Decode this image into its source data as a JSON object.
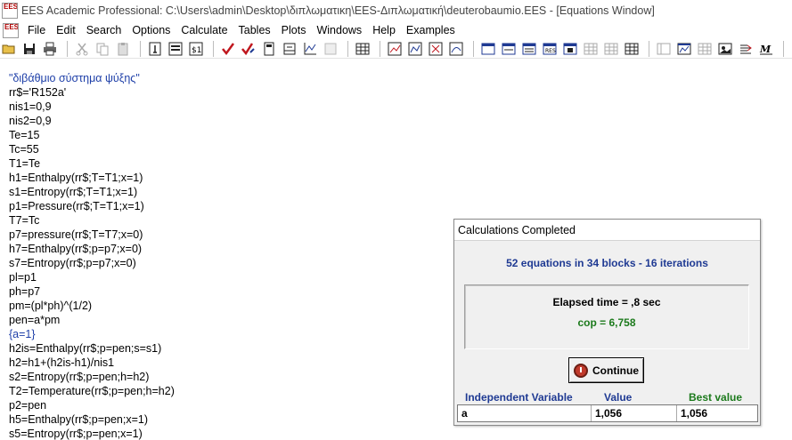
{
  "window": {
    "title": "EES Academic Professional:  C:\\Users\\admin\\Desktop\\διπλωματικη\\EES-Διπλωματική\\deuterobaumio.EES - [Equations Window]",
    "app_icon_text": "EES"
  },
  "menu": {
    "items": [
      "File",
      "Edit",
      "Search",
      "Options",
      "Calculate",
      "Tables",
      "Plots",
      "Windows",
      "Help",
      "Examples"
    ]
  },
  "toolbar": {
    "buttons": [
      {
        "name": "open-icon"
      },
      {
        "name": "save-icon"
      },
      {
        "name": "print-icon"
      },
      {
        "name": "cut-icon"
      },
      {
        "name": "copy-icon"
      },
      {
        "name": "paste-icon"
      },
      {
        "name": "info-icon"
      },
      {
        "name": "function-info-icon"
      },
      {
        "name": "units-icon"
      },
      {
        "name": "check-icon"
      },
      {
        "name": "solve-icon"
      },
      {
        "name": "calculator-icon"
      },
      {
        "name": "property-plot-icon"
      },
      {
        "name": "plot-icon"
      },
      {
        "name": "disabled-icon"
      },
      {
        "name": "table-icon"
      },
      {
        "name": "chart-line-icon"
      },
      {
        "name": "chart-line2-icon"
      },
      {
        "name": "chart-x-icon"
      },
      {
        "name": "chart-curve-icon"
      },
      {
        "name": "eqn-window-icon"
      },
      {
        "name": "formatted-eqn-icon"
      },
      {
        "name": "solution-icon"
      },
      {
        "name": "residuals-icon"
      },
      {
        "name": "param-table-icon"
      },
      {
        "name": "lookup-table-icon"
      },
      {
        "name": "array-table-icon"
      },
      {
        "name": "integral-table-icon"
      },
      {
        "name": "diagram-icon"
      },
      {
        "name": "plot-window-icon"
      },
      {
        "name": "grid-icon"
      },
      {
        "name": "picture-icon"
      },
      {
        "name": "text-icon"
      },
      {
        "name": "macro-icon"
      },
      {
        "name": "help-icon"
      },
      {
        "name": "pointer-icon"
      }
    ]
  },
  "equations": [
    {
      "text": "\"διβάθμιο σύστημα ψύξης\"",
      "comment": true
    },
    {
      "text": "rr$='R152a'"
    },
    {
      "text": "nis1=0,9"
    },
    {
      "text": "nis2=0,9"
    },
    {
      "text": "Te=15"
    },
    {
      "text": "Tc=55"
    },
    {
      "text": "T1=Te"
    },
    {
      "text": "h1=Enthalpy(rr$;T=T1;x=1)"
    },
    {
      "text": "s1=Entropy(rr$;T=T1;x=1)"
    },
    {
      "text": "p1=Pressure(rr$;T=T1;x=1)"
    },
    {
      "text": "T7=Tc"
    },
    {
      "text": "p7=pressure(rr$;T=T7;x=0)"
    },
    {
      "text": "h7=Enthalpy(rr$;p=p7;x=0)"
    },
    {
      "text": "s7=Entropy(rr$;p=p7;x=0)"
    },
    {
      "text": "pl=p1"
    },
    {
      "text": "ph=p7"
    },
    {
      "text": "pm=(pl*ph)^(1/2)"
    },
    {
      "text": "pen=a*pm"
    },
    {
      "text": "{a=1}",
      "comment": true
    },
    {
      "text": "h2is=Enthalpy(rr$;p=pen;s=s1)"
    },
    {
      "text": "h2=h1+(h2is-h1)/nis1"
    },
    {
      "text": "s2=Entropy(rr$;p=pen;h=h2)"
    },
    {
      "text": "T2=Temperature(rr$;p=pen;h=h2)"
    },
    {
      "text": "p2=pen"
    },
    {
      "text": "h5=Enthalpy(rr$;p=pen;x=1)"
    },
    {
      "text": "s5=Entropy(rr$;p=pen;x=1)"
    }
  ],
  "dialog": {
    "title": "Calculations Completed",
    "summary": "52 equations in 34 blocks - 16 iterations",
    "elapsed": "Elapsed time = ,8 sec",
    "cop": "cop = 6,758",
    "continue_label": "Continue",
    "table": {
      "headers": {
        "variable": "Independent Variable",
        "value": "Value",
        "best": "Best value"
      },
      "rows": [
        {
          "variable": "a",
          "value": "1,056",
          "best": "1,056"
        }
      ]
    },
    "colors": {
      "summary": "#1f3a93",
      "cop": "#1c7a1c",
      "best_header": "#1c7a1c"
    }
  }
}
